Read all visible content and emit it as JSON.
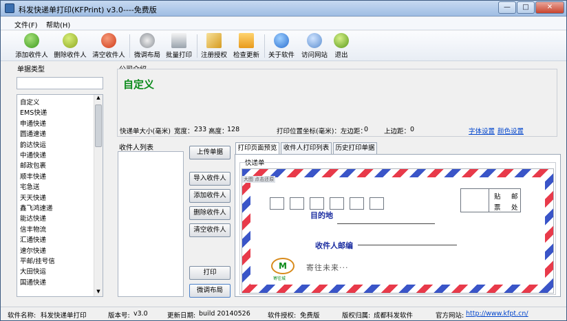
{
  "window": {
    "title": "科发快递单打印(KFPrint) v3.0----免费版"
  },
  "menu": {
    "file": "文件(F)",
    "help": "帮助(H)"
  },
  "toolbar": {
    "add": "添加收件人",
    "del": "删除收件人",
    "clear": "清空收件人",
    "layout": "微调布局",
    "batch": "批量打印",
    "register": "注册授权",
    "update": "检查更新",
    "about": "关于软件",
    "visit": "访问网站",
    "exit": "退出"
  },
  "sidebar": {
    "label": "单据类型",
    "search_value": "",
    "items": [
      "自定义",
      "EMS快递",
      "申通快递",
      "圆通速递",
      "韵达快运",
      "中通快递",
      "邮政包裹",
      "顺丰快递",
      "宅急送",
      "天天快递",
      "鑫飞鸿速递",
      "能达快递",
      "信丰物流",
      "汇通快递",
      "速尔快递",
      "平邮/挂号信",
      "大田快运",
      "国通快递"
    ]
  },
  "company": {
    "label": "公司介绍",
    "name": "自定义",
    "size_label": "快递单大小(毫米)",
    "width_label": "宽度：",
    "width": "233",
    "height_label": "高度：",
    "height": "128",
    "pos_label": "打印位置坐标(毫米)：左边距：",
    "left": "0",
    "top_label": "上边距：",
    "top": "0",
    "font_link": "字体设置",
    "color_link": "颜色设置"
  },
  "recipients": {
    "label": "收件人列表",
    "upload": "上传单据",
    "import": "导入收件人",
    "add": "添加收件人",
    "delete": "删除收件人",
    "clear": "清空收件人",
    "print": "打印",
    "adjust": "微调布局"
  },
  "tabs": [
    "打印页面预览",
    "收件人打印列表",
    "历史打印单据"
  ],
  "preview": {
    "group": "快递单",
    "mini": "大图 点击还原",
    "stamp_top_l": "贴",
    "stamp_top_r": "邮",
    "stamp_bot_l": "票",
    "stamp_bot_r": "处",
    "dest": "目的地",
    "postcode": "收件人邮编",
    "logo_text": "寄往未来···",
    "logo_mark": "M",
    "logo_small": "寄往城"
  },
  "status": {
    "name_label": "软件名称:",
    "name": "科发快递单打印",
    "ver_label": "版本号:",
    "ver": "v3.0",
    "date_label": "更新日期:",
    "date": "build 20140526",
    "lic_label": "软件授权:",
    "lic": "免费版",
    "owner_label": "版权归属:",
    "owner": "成都科发软件",
    "site_label": "官方网站:",
    "site": "http://www.kfpt.cn/"
  },
  "colors": {
    "accent_green": "#0a8a1a",
    "link": "#0044cc",
    "stripe_blue": "#3a55c8",
    "stripe_red": "#e83a4a"
  }
}
